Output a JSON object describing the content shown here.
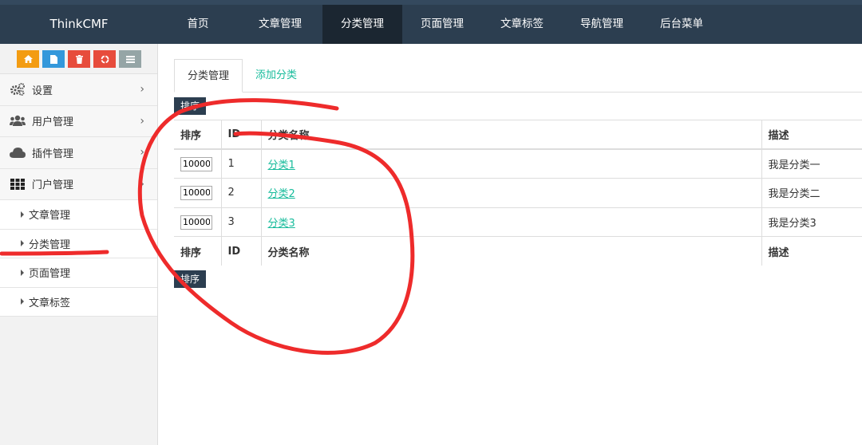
{
  "brand": "ThinkCMF",
  "nav": [
    {
      "label": "首页",
      "active": false
    },
    {
      "label": "文章管理",
      "active": false
    },
    {
      "label": "分类管理",
      "active": true
    },
    {
      "label": "页面管理",
      "active": false
    },
    {
      "label": "文章标签",
      "active": false
    },
    {
      "label": "导航管理",
      "active": false
    },
    {
      "label": "后台菜单",
      "active": false
    }
  ],
  "shortcuts": [
    {
      "icon": "home-icon",
      "color": "#f39c12"
    },
    {
      "icon": "file-icon",
      "color": "#3498db"
    },
    {
      "icon": "trash-icon",
      "color": "#e74c3c"
    },
    {
      "icon": "recycle-icon",
      "color": "#e74c3c"
    },
    {
      "icon": "list-icon",
      "color": "#95a5a6"
    }
  ],
  "sidebar": {
    "menus": [
      {
        "label": "设置",
        "icon": "gears-icon"
      },
      {
        "label": "用户管理",
        "icon": "users-icon"
      },
      {
        "label": "插件管理",
        "icon": "cloud-icon"
      },
      {
        "label": "门户管理",
        "icon": "grid-icon"
      }
    ],
    "submenus": [
      {
        "label": "文章管理"
      },
      {
        "label": "分类管理"
      },
      {
        "label": "页面管理"
      },
      {
        "label": "文章标签"
      }
    ]
  },
  "tabs": [
    {
      "label": "分类管理",
      "active": true
    },
    {
      "label": "添加分类",
      "active": false
    }
  ],
  "sort_button": "排序",
  "table": {
    "headers": {
      "sort": "排序",
      "id": "ID",
      "name": "分类名称",
      "desc": "描述"
    },
    "rows": [
      {
        "sort": "10000",
        "id": "1",
        "name": "分类1",
        "desc": "我是分类一"
      },
      {
        "sort": "10000",
        "id": "2",
        "name": "分类2",
        "desc": "我是分类二"
      },
      {
        "sort": "10000",
        "id": "3",
        "name": "分类3",
        "desc": "我是分类3"
      }
    ]
  },
  "colors": {
    "topbar": "#2c3e50",
    "accent": "#18bc9c",
    "annotation": "#ee2b2b"
  }
}
